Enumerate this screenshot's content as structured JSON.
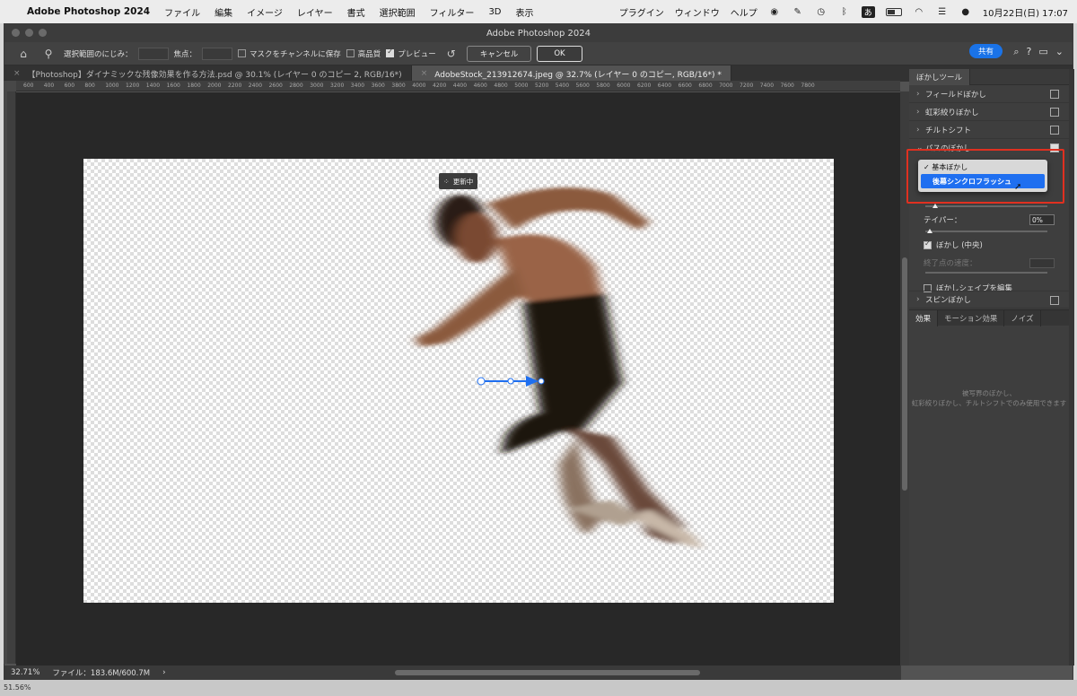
{
  "menubar": {
    "app_name": "Adobe Photoshop 2024",
    "items": [
      "ファイル",
      "編集",
      "イメージ",
      "レイヤー",
      "書式",
      "選択範囲",
      "フィルター",
      "3D",
      "表示"
    ],
    "right_items": [
      "プラグイン",
      "ウィンドウ",
      "ヘルプ"
    ],
    "ime": "あ",
    "datetime": "10月22日(日)  17:07"
  },
  "window": {
    "title": "Adobe Photoshop 2024"
  },
  "options": {
    "feather_label": "選択範囲のにじみ：",
    "focus_label": "焦点：",
    "save_mask_label": "マスクをチャンネルに保存",
    "high_quality_label": "高品質",
    "preview_label": "プレビュー",
    "cancel_label": "キャンセル",
    "ok_label": "OK",
    "share_label": "共有"
  },
  "tabs": [
    {
      "label": "【Photoshop】ダイナミックな残像効果を作る方法.psd @ 30.1% (レイヤー 0 のコピー 2, RGB/16*)"
    },
    {
      "label": "AdobeStock_213912674.jpeg @ 32.7% (レイヤー 0 のコピー, RGB/16*) *"
    }
  ],
  "ruler": {
    "ticks": [
      "600",
      "400",
      "600",
      "800",
      "1000",
      "1200",
      "1400",
      "1600",
      "1800",
      "2000",
      "2200",
      "2400",
      "2600",
      "2800",
      "3000",
      "3200",
      "3400",
      "3600",
      "3800",
      "4000",
      "4200",
      "4400",
      "4600",
      "4800",
      "5000",
      "5200",
      "5400",
      "5600",
      "5800",
      "6000",
      "6200",
      "6400",
      "6600",
      "6800",
      "7000",
      "7200",
      "7400",
      "7600",
      "7800"
    ]
  },
  "canvas": {
    "status_chip": "更新中"
  },
  "statusbar": {
    "zoom": "32.71%",
    "file_info": "ファイル：183.6M/600.7M",
    "arrow": "›"
  },
  "bottom_strip": {
    "zoom": "51.56%"
  },
  "panel": {
    "title": "ぼかしツール",
    "blur_items": [
      {
        "label": "フィールドぼかし",
        "checked": false
      },
      {
        "label": "虹彩絞りぼかし",
        "checked": false
      },
      {
        "label": "チルトシフト",
        "checked": false
      },
      {
        "label": "パスのぼかし",
        "checked": true
      }
    ],
    "dropdown": {
      "option_basic": "✓ 基本ぼかし",
      "option_rear_sync": "後幕シンクロフラッシュ"
    },
    "taper_label": "テイパー：",
    "taper_value": "0%",
    "center_blur_label": "ぼかし (中央)",
    "end_speed_label": "終了点の速度：",
    "edit_shape_label": "ぼかしシェイプを編集",
    "spin_label": "スピンぼかし",
    "effects_tabs": [
      "効果",
      "モーション効果",
      "ノイズ"
    ],
    "effects_note_1": "被写界のぼかし、",
    "effects_note_2": "虹彩絞りぼかし、チルトシフトでのみ使用できます"
  }
}
